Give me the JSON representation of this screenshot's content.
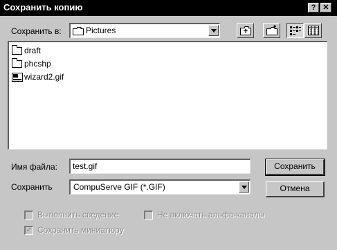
{
  "window": {
    "title": "Сохранить копию",
    "help_button": "?",
    "close_button": "✕"
  },
  "save_in": {
    "label": "Сохранить в:",
    "value": "Pictures"
  },
  "toolbar": {
    "icons": [
      "up-folder-icon",
      "new-folder-icon",
      "list-view-icon",
      "details-view-icon"
    ]
  },
  "file_list": {
    "items": [
      {
        "name": "draft",
        "type": "folder"
      },
      {
        "name": "phcshp",
        "type": "folder"
      },
      {
        "name": "wizard2.gif",
        "type": "gif"
      }
    ]
  },
  "filename": {
    "label": "Имя файла:",
    "value": "test.gif"
  },
  "filetype": {
    "label": "Сохранить",
    "value": "CompuServe GIF (*.GIF)"
  },
  "buttons": {
    "save": "Сохранить",
    "cancel": "Отмена"
  },
  "options": {
    "flatten": {
      "label": "Выполнить сведение",
      "checked": false,
      "enabled": false
    },
    "exclude_alpha": {
      "label": "Не включать альфа-каналы",
      "checked": false,
      "enabled": false
    },
    "save_thumbnail": {
      "label": "Сохранить миниатюру",
      "checked": true,
      "enabled": false
    }
  }
}
